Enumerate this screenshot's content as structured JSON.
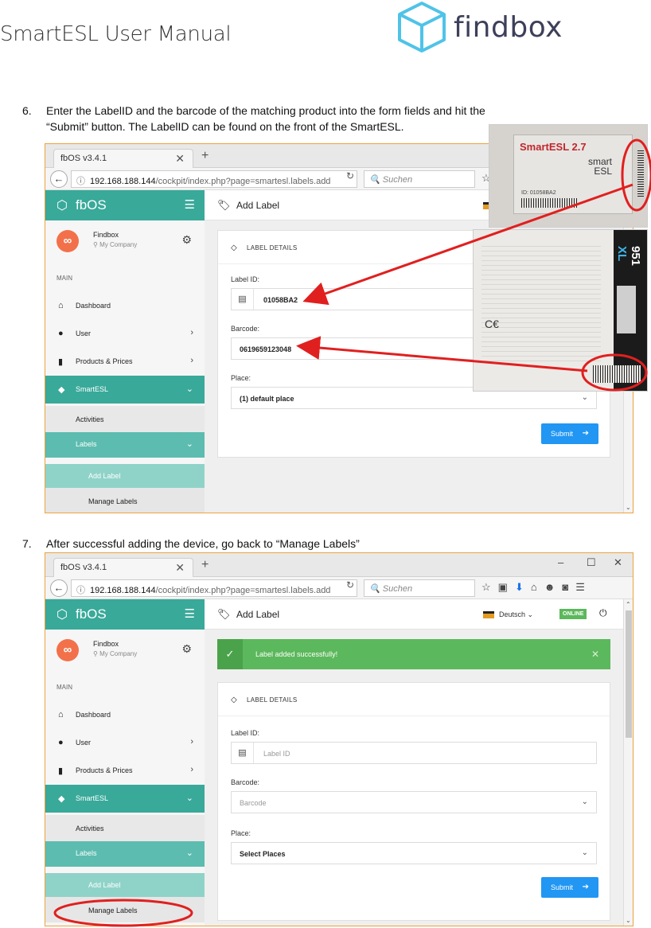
{
  "document": {
    "title": "SmartESL User Manual",
    "logo_text": "findbox",
    "steps": [
      {
        "number": "6.",
        "line1": "Enter the LabelID and the barcode of the matching product into the form fields and hit the",
        "line2": "“Submit” button. The LabelID can be found on the front of the SmartESL."
      },
      {
        "number": "7.",
        "line1": "After successful adding the device, go back to “Manage Labels”"
      }
    ]
  },
  "browser": {
    "tab_title": "fbOS v3.4.1",
    "url_host": "192.168.188.144",
    "url_path": "/cockpit/index.php?page=smartesl.labels.add",
    "search_placeholder": "Suchen",
    "window_controls": [
      "–",
      "☐",
      "✕"
    ]
  },
  "app": {
    "brand": "fbOS",
    "user_name": "Findbox",
    "user_company": "My Company",
    "section_label": "MAIN",
    "nav": {
      "dashboard": "Dashboard",
      "user": "User",
      "products": "Products & Prices",
      "smartesl": "SmartESL",
      "activities": "Activities",
      "labels": "Labels",
      "add_label": "Add Label",
      "manage_labels": "Manage Labels"
    },
    "page_title": "Add Label",
    "language": "Deutsch",
    "status": "ONLINE",
    "alert_message": "Label added successfully!",
    "card_title": "LABEL DETAILS",
    "label_id_label": "Label ID:",
    "barcode_label": "Barcode:",
    "place_label": "Place:",
    "submit_label": "Submit",
    "form_filled": {
      "label_id_value": "01058BA2",
      "barcode_value": "0619659123048",
      "place_value": "(1) default place"
    },
    "form_empty": {
      "label_id_placeholder": "Label ID",
      "barcode_placeholder": "Barcode",
      "place_value": "Select Places"
    }
  },
  "photos": {
    "esl_title": "SmartESL 2.7",
    "esl_brand_line1": "smart",
    "esl_brand_line2": "ESL",
    "esl_id": "ID: 01058BA2",
    "product_code": "951",
    "product_variant": "XL"
  },
  "colors": {
    "teal": "#39a99a",
    "annotation_red": "#e0201f",
    "submit_blue": "#2196f3",
    "success_green": "#5cb85c",
    "frame_orange": "#f0a23c"
  }
}
